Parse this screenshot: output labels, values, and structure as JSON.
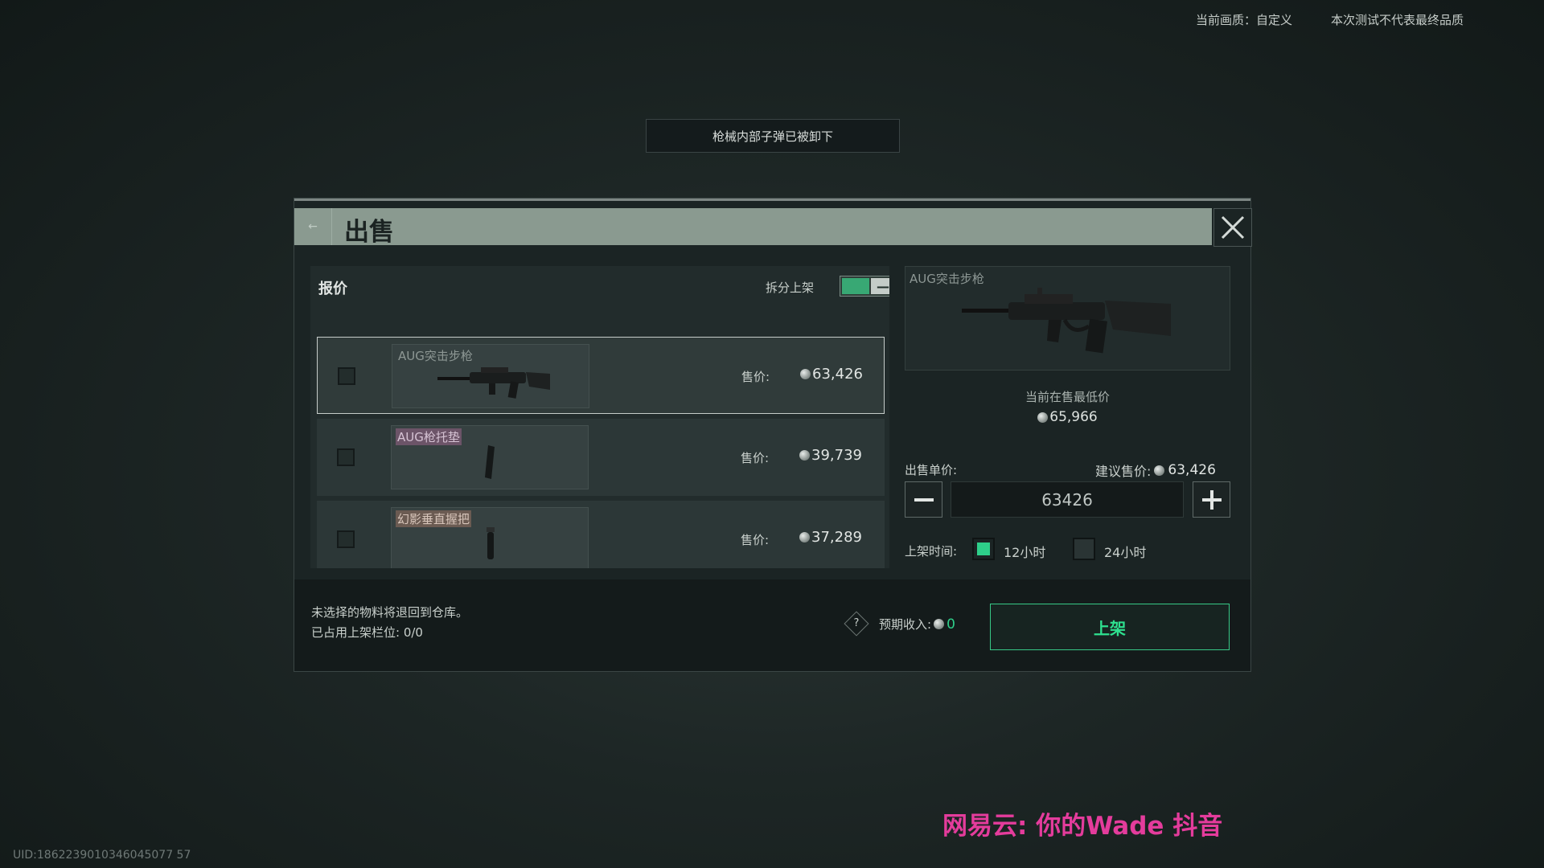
{
  "topbar": {
    "quality": "当前画质：自定义",
    "disclaimer": "本次测试不代表最终品质"
  },
  "notice": "枪械内部子弹已被卸下",
  "dialog": {
    "title": "出售",
    "close_icon": "close-icon",
    "offer_panel": {
      "title": "报价",
      "split_label": "拆分上架",
      "split_toggle_on": true,
      "price_label": "售价:",
      "items": [
        {
          "name": "AUG突击步枪",
          "price": "63,426",
          "selected": true,
          "checked": false
        },
        {
          "name": "AUG枪托垫",
          "price": "39,739",
          "selected": false,
          "checked": false
        },
        {
          "name": "幻影垂直握把",
          "price": "37,289",
          "selected": false,
          "checked": false
        }
      ]
    },
    "detail": {
      "item_name": "AUG突击步枪",
      "lowest_label": "当前在售最低价",
      "lowest_price": "65,966",
      "unit_price_label": "出售单价:",
      "suggest_label": "建议售价:",
      "suggest_price": "63,426",
      "unit_price_value": "63426",
      "duration_label": "上架时间:",
      "duration_options": [
        {
          "label": "12小时",
          "checked": true
        },
        {
          "label": "24小时",
          "checked": false
        }
      ]
    },
    "footer": {
      "note1": "未选择的物料将退回到仓库。",
      "note2": "已占用上架栏位: 0/0",
      "expected_label": "预期收入:",
      "expected_value": "0",
      "list_button": "上架"
    }
  },
  "watermark": "网易云: 你的Wade 抖音",
  "uid": "UID:1862239010346045077 57"
}
